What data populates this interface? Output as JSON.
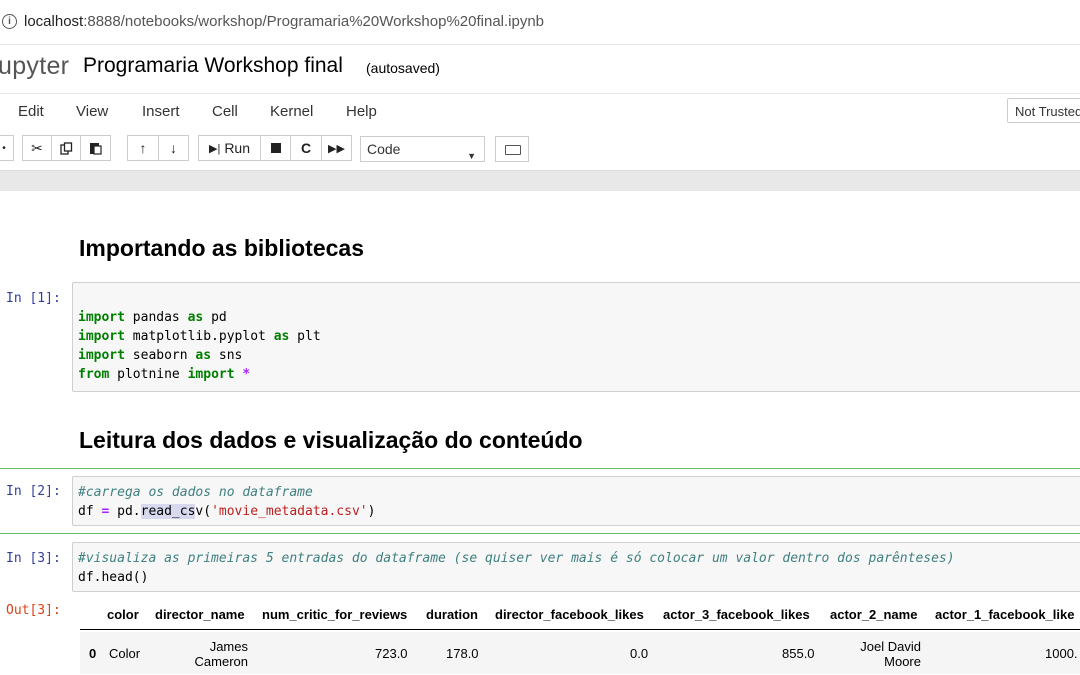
{
  "address_bar": {
    "info_icon": "info-circle-icon",
    "url_host": "localhost",
    "url_path": ":8888/notebooks/workshop/Programaria%20Workshop%20final.ipynb"
  },
  "header": {
    "logo_text": "upyter",
    "notebook_name": "Programaria Workshop final",
    "autosave": "(autosaved)"
  },
  "menu": {
    "items": [
      "Edit",
      "View",
      "Insert",
      "Cell",
      "Kernel",
      "Help"
    ],
    "trusted": "Not Trusted"
  },
  "toolbar": {
    "run_label": "Run",
    "cell_type": "Code",
    "icons": [
      "cut-icon",
      "copy-icon",
      "paste-icon",
      "move-up-icon",
      "move-down-icon",
      "run-icon",
      "stop-icon",
      "restart-icon",
      "fast-forward-icon",
      "keyboard-icon"
    ]
  },
  "notebook": {
    "heading1": "Importando as bibliotecas",
    "heading2": "Leitura dos dados e visualização do conteúdo",
    "cell1": {
      "prompt": "In [1]:",
      "lines": [
        [
          "import",
          " pandas ",
          "as",
          " pd"
        ],
        [
          "import",
          " matplotlib.pyplot ",
          "as",
          " plt"
        ],
        [
          "import",
          " seaborn ",
          "as",
          " sns"
        ],
        [
          "from",
          " plotnine ",
          "import",
          " ",
          "*"
        ]
      ]
    },
    "cell2": {
      "prompt": "In [2]:",
      "comment": "#carrega os dados no dataframe",
      "code_a": "df ",
      "code_eq": "=",
      "code_b": " pd.",
      "code_hl": "read_cs",
      "code_c": "v(",
      "code_str": "'movie_metadata.csv'",
      "code_d": ")"
    },
    "cell3": {
      "prompt": "In [3]:",
      "comment": "#visualiza as primeiras 5 entradas do dataframe (se quiser ver mais é só colocar um valor dentro dos parênteses)",
      "code": "df.head()"
    },
    "output": {
      "prompt": "Out[3]:",
      "columns": [
        "color",
        "director_name",
        "num_critic_for_reviews",
        "duration",
        "director_facebook_likes",
        "actor_3_facebook_likes",
        "actor_2_name",
        "actor_1_facebook_like"
      ],
      "row": {
        "index": "0",
        "color": "Color",
        "director_name_1": "James",
        "director_name_2": "Cameron",
        "num_critic_for_reviews": "723.0",
        "duration": "178.0",
        "director_facebook_likes": "0.0",
        "actor_3_facebook_likes": "855.0",
        "actor_2_name_1": "Joel David",
        "actor_2_name_2": "Moore",
        "actor_1_facebook_likes": "1000."
      }
    }
  }
}
